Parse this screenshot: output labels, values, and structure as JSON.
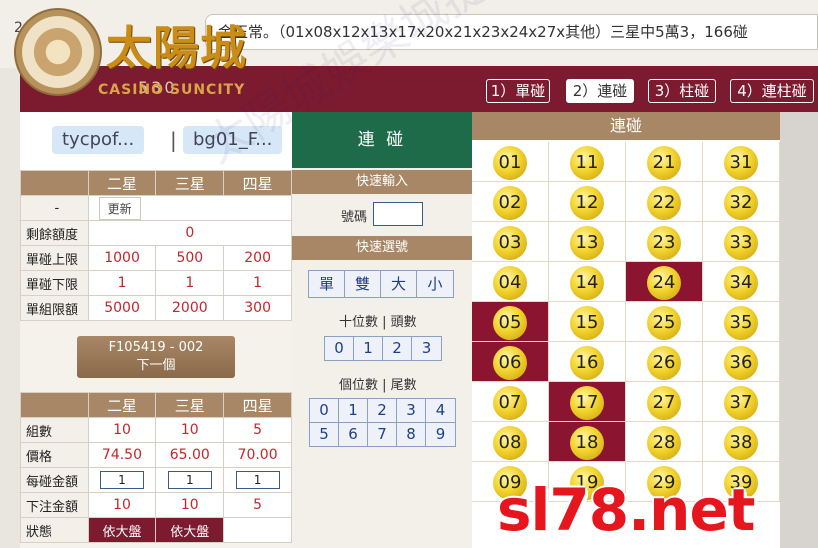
{
  "header": {
    "date_fragment": "2 20",
    "marquee": "金正常。（01x08x12x13x17x20x21x23x24x27x其他）三星中5萬3，166碰"
  },
  "logo": {
    "title": "太陽城",
    "subtitle": "CASINO SUNCITY",
    "num": "530"
  },
  "nav": {
    "tabs": [
      {
        "label": "1）單碰",
        "active": false
      },
      {
        "label": "2）連碰",
        "active": true
      },
      {
        "label": "3）柱碰",
        "active": false
      },
      {
        "label": "4）連柱碰",
        "active": false
      }
    ]
  },
  "user": {
    "account": "tycpof...",
    "separator": "|",
    "sub_account": "bg01_F..."
  },
  "limits": {
    "headers": [
      "-",
      "二星",
      "三星",
      "四星"
    ],
    "update_label": "更新",
    "rows": [
      {
        "label": "剩餘額度",
        "values": [
          "0"
        ]
      },
      {
        "label": "單碰上限",
        "values": [
          "1000",
          "500",
          "200"
        ]
      },
      {
        "label": "單碰下限",
        "values": [
          "1",
          "1",
          "1"
        ]
      },
      {
        "label": "單組限額",
        "values": [
          "5000",
          "2000",
          "300"
        ]
      }
    ]
  },
  "next_button": {
    "code": "F105419 - 002",
    "label": "下一個"
  },
  "bet": {
    "headers": [
      "",
      "二星",
      "三星",
      "四星"
    ],
    "groups": {
      "label": "組數",
      "values": [
        "10",
        "10",
        "5"
      ]
    },
    "price": {
      "label": "價格",
      "values": [
        "74.50",
        "65.00",
        "70.00"
      ]
    },
    "each": {
      "label": "每碰金額",
      "values": [
        "1",
        "1",
        "1"
      ]
    },
    "total": {
      "label": "下注金額",
      "values": [
        "10",
        "10",
        "5"
      ]
    },
    "status": {
      "label": "狀態",
      "values": [
        "依大盤",
        "依大盤"
      ]
    }
  },
  "mid": {
    "mode_title": "連 碰",
    "quick_input": "快速輸入",
    "code_label": "號碼",
    "quick_select": "快速選號",
    "parity_keys": [
      "單",
      "雙",
      "大",
      "小"
    ],
    "tens_label": "十位數 | 頭數",
    "tens_keys": [
      "0",
      "1",
      "2",
      "3"
    ],
    "ones_label": "個位數 | 尾數",
    "ones_keys_row1": [
      "0",
      "1",
      "2",
      "3",
      "4"
    ],
    "ones_keys_row2": [
      "5",
      "6",
      "7",
      "8",
      "9"
    ]
  },
  "numbers": {
    "title": "連碰",
    "selected": [
      "05",
      "06",
      "17",
      "18",
      "24"
    ],
    "columns": [
      [
        "01",
        "02",
        "03",
        "04",
        "05",
        "06",
        "07",
        "08",
        "09"
      ],
      [
        "11",
        "12",
        "13",
        "14",
        "15",
        "16",
        "17",
        "18",
        "19"
      ],
      [
        "21",
        "22",
        "23",
        "24",
        "25",
        "26",
        "27",
        "28",
        "29"
      ],
      [
        "31",
        "32",
        "33",
        "34",
        "35",
        "36",
        "37",
        "38",
        "39"
      ]
    ]
  },
  "watermark": {
    "text": "太陽城娛樂城提供",
    "site": "sl78.net"
  }
}
